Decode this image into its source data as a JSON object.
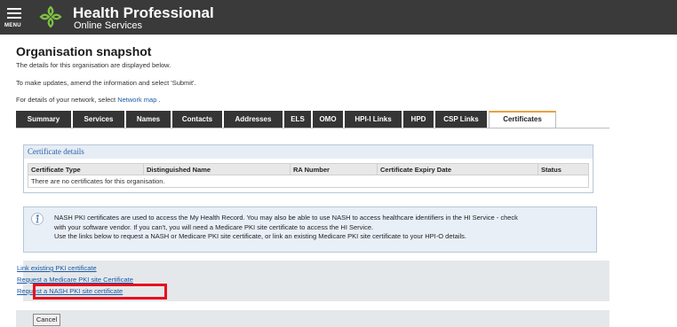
{
  "header": {
    "menu_label": "MENU",
    "title": "Health Professional",
    "subtitle": "Online Services"
  },
  "page": {
    "title": "Organisation snapshot",
    "intro": "The details for this organisation are displayed below.",
    "update_note": "To make updates, amend the information and select 'Submit'.",
    "network_prefix": "For details of your network, select ",
    "network_link": "Network map",
    "network_suffix": " ."
  },
  "tabs": [
    {
      "label": "Summary"
    },
    {
      "label": "Services"
    },
    {
      "label": "Names"
    },
    {
      "label": "Contacts"
    },
    {
      "label": "Addresses"
    },
    {
      "label": "ELS"
    },
    {
      "label": "OMO"
    },
    {
      "label": "HPI-I Links"
    },
    {
      "label": "HPD"
    },
    {
      "label": "CSP Links"
    },
    {
      "label": "Certificates"
    }
  ],
  "certificates": {
    "heading": "Certificate details",
    "columns": [
      "Certificate Type",
      "Distinguished Name",
      "RA Number",
      "Certificate Expiry Date",
      "Status"
    ],
    "empty_message": "There are no certificates for this organisation."
  },
  "info": {
    "line1": "NASH PKI certificates are used to access the My Health Record. You may also be able to use NASH to access healthcare identifiers in the HI Service - check",
    "line2": "with your software vendor. If you can't, you will need a Medicare PKI site certificate to access the HI Service.",
    "line3": "Use the links below to request a NASH or Medicare PKI site certificate, or link an existing Medicare PKI site certificate to your HPI-O details."
  },
  "links": {
    "link_existing": "Link existing PKI certificate",
    "request_medicare": "Request a Medicare PKI site Certificate",
    "request_nash": "Request a NASH PKI site certificate"
  },
  "footer": {
    "cancel_label": "Cancel"
  },
  "colors": {
    "topbar": "#3a3a3a",
    "tab_dark": "#353535",
    "link": "#1a5aa8",
    "highlight": "#e8101e",
    "active_tab_accent": "#e8a23a"
  }
}
